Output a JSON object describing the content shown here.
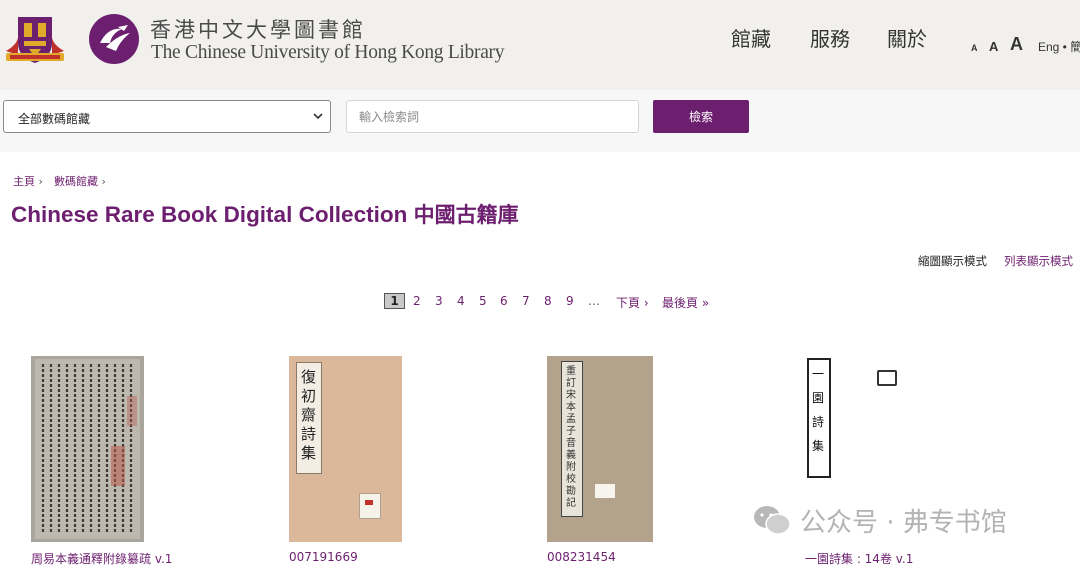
{
  "header": {
    "brand_zh": "香港中文大學圖書館",
    "brand_en": "The Chinese University of Hong Kong Library",
    "nav": [
      "館藏",
      "服務",
      "關於"
    ],
    "font_sizes": [
      "A",
      "A",
      "A"
    ],
    "language": "Eng • 簡"
  },
  "search": {
    "scope_selected": "全部數碼館藏",
    "placeholder": "輸入檢索詞",
    "button_label": "檢索"
  },
  "breadcrumb": [
    "主頁",
    "數碼館藏"
  ],
  "breadcrumb_separator": "›",
  "page_title": "Chinese Rare Book Digital Collection",
  "page_title_zh": "中國古籍庫",
  "view_modes": {
    "grid": "縮圖顯示模式",
    "list": "列表顯示模式"
  },
  "pagination": {
    "current": "1",
    "pages": [
      "2",
      "3",
      "4",
      "5",
      "6",
      "7",
      "8",
      "9"
    ],
    "ellipsis": "…",
    "next": "下頁 ›",
    "last": "最後頁 »"
  },
  "items": [
    {
      "caption": "周易本義通釋附錄纂疏 v.1"
    },
    {
      "caption": "007191669",
      "label_text": "復初齋詩集"
    },
    {
      "caption": "008231454",
      "label_text": "重訂宋本孟子音義附校勘記"
    },
    {
      "caption": "一園詩集 : 14卷 v.1",
      "label_text": "一園詩集"
    }
  ],
  "watermark": "公众号 · 弗专书馆",
  "colors": {
    "brand_purple": "#6d1f6f",
    "header_bg": "#f1f0ed",
    "crest_red": "#c0312b",
    "crest_gold": "#e0a92a"
  }
}
